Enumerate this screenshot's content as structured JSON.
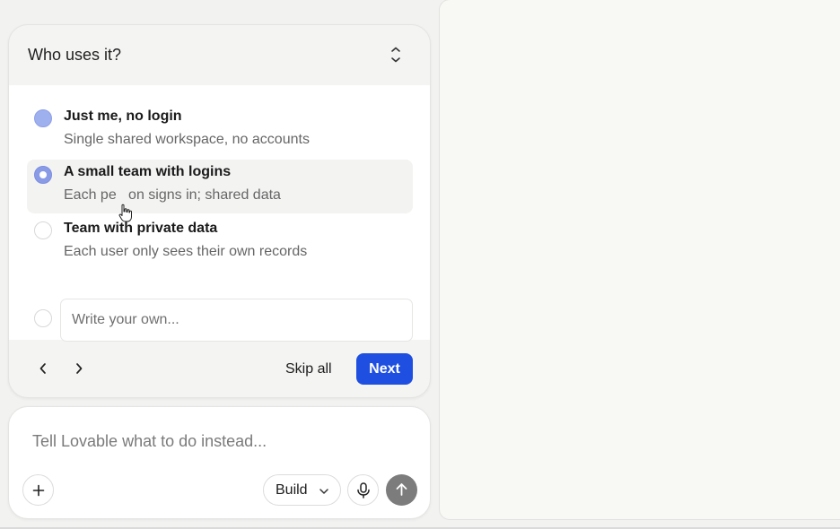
{
  "question": {
    "title": "Who uses it?",
    "options": [
      {
        "title": "Just me, no login",
        "description": "Single shared workspace, no accounts"
      },
      {
        "title": "A small team with logins",
        "description": "Each person signs in; shared data",
        "description_visible": "Each pe   on signs in; shared data"
      },
      {
        "title": "Team with private data",
        "description": "Each user only sees their own records"
      }
    ],
    "write_own_placeholder": "Write your own...",
    "skip_label": "Skip all",
    "next_label": "Next"
  },
  "chat": {
    "placeholder": "Tell Lovable what to do instead...",
    "mode_label": "Build"
  },
  "colors": {
    "accent": "#1f4fe0",
    "radio_selected": "#8a9be6",
    "send_button": "#7c7c7c"
  },
  "icons": [
    "collapse-icon",
    "chevron-left-icon",
    "chevron-right-icon",
    "plus-icon",
    "chevron-down-icon",
    "microphone-icon",
    "arrow-up-icon",
    "hand-cursor-icon"
  ]
}
